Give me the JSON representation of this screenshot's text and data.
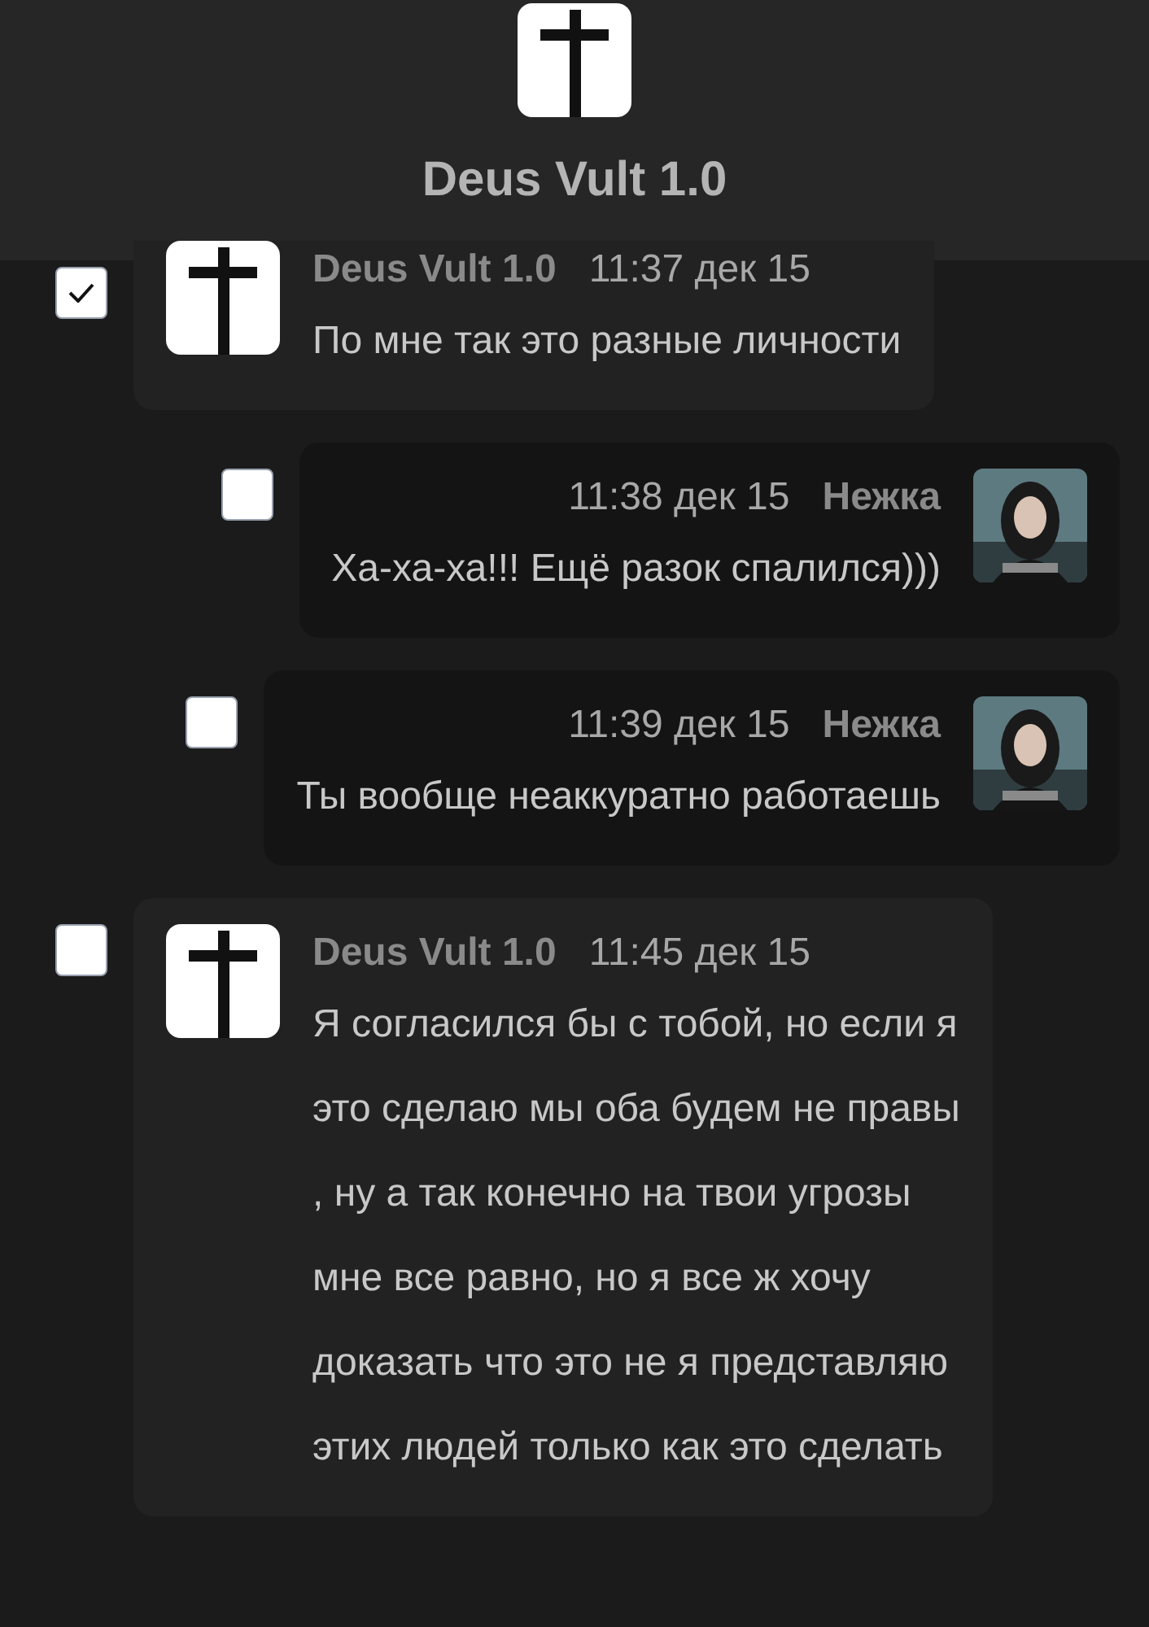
{
  "header": {
    "title": "Deus Vult 1.0"
  },
  "messages": [
    {
      "kind": "outgoing",
      "selected": true,
      "author": "Deus Vult 1.0",
      "time": "11:37 дек 15",
      "lines": [
        "По мне так это разные личности"
      ]
    },
    {
      "kind": "incoming",
      "selected": false,
      "author": "Нежка",
      "time": "11:38 дек 15",
      "lines": [
        "Ха-ха-ха!!! Ещё разок спалился)))"
      ]
    },
    {
      "kind": "incoming",
      "selected": false,
      "author": "Нежка",
      "time": "11:39 дек 15",
      "lines": [
        "Ты вообще неаккуратно работаешь"
      ]
    },
    {
      "kind": "outgoing",
      "selected": false,
      "author": "Deus Vult 1.0",
      "time": "11:45 дек 15",
      "lines": [
        "Я согласился бы с тобой, но если я",
        "это сделаю мы оба будем не правы",
        ", ну а так конечно на твои угрозы",
        "мне все равно, но я все ж хочу",
        "доказать что это не я представляю",
        "этих людей только как это сделать"
      ]
    }
  ]
}
